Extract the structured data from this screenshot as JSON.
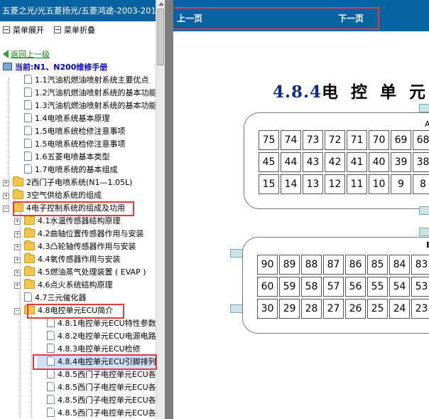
{
  "left_panel": {
    "title": "五菱之光/光五菱扬光/五菱鸿途-2003-2010-",
    "toolbar": {
      "expand_label": "菜单展开",
      "collapse_label": "菜单折叠"
    },
    "back_label": "返回上一级",
    "current_label": "当前:N1、N200维修手册",
    "tree": [
      {
        "label": "1.1汽油机燃油喷射系统主要优点",
        "type": "doc",
        "level": 1
      },
      {
        "label": "1.2汽油机燃油喷射系统的基本功能",
        "type": "doc",
        "level": 1
      },
      {
        "label": "1.3汽油机燃油喷射系统的基本功能",
        "type": "doc",
        "level": 1
      },
      {
        "label": "1.4电喷系统基本原理",
        "type": "doc",
        "level": 1
      },
      {
        "label": "1.5电喷系统检修注意事项",
        "type": "doc",
        "level": 1
      },
      {
        "label": "1.5电喷系统检修注意事项",
        "type": "doc",
        "level": 1
      },
      {
        "label": "1.6五菱电喷基本类型",
        "type": "doc",
        "level": 1
      },
      {
        "label": "1.7电喷系统的基本组成",
        "type": "doc",
        "level": 1
      },
      {
        "label": "2西门子电喷系统(N1—1.05L)",
        "type": "folder",
        "level": 0
      },
      {
        "label": "3空气供给系统的组成",
        "type": "folder",
        "level": 0
      },
      {
        "label": "4电子控制系统的组成及功用",
        "type": "folder",
        "level": 0,
        "expanded": true
      },
      {
        "label": "4.1水温传感器结构原理",
        "type": "folder",
        "level": 1
      },
      {
        "label": "4.2曲轴位置传感器作用与安装",
        "type": "folder",
        "level": 1
      },
      {
        "label": "4.3凸轮轴传感器作用与安装",
        "type": "folder",
        "level": 1
      },
      {
        "label": "4.4氧传感器作用与安装",
        "type": "folder",
        "level": 1
      },
      {
        "label": "4.5燃油蒸气处理装置 ( EVAP )",
        "type": "folder",
        "level": 1
      },
      {
        "label": "4.6点火系统结构原理",
        "type": "folder",
        "level": 1
      },
      {
        "label": "4.7三元催化器",
        "type": "doc",
        "level": 1
      },
      {
        "label": "4.8电控单元ECU简介",
        "type": "folder",
        "level": 1,
        "expanded": true
      },
      {
        "label": "4.8.1电控单元ECU特性参数",
        "type": "doc",
        "level": 2
      },
      {
        "label": "4.8.2电控单元ECU电源电路",
        "type": "doc",
        "level": 2
      },
      {
        "label": "4.8.3电控单元ECU检修",
        "type": "doc",
        "level": 2
      },
      {
        "label": "4.8.4电控单元ECU引脚排列",
        "type": "doc",
        "level": 2,
        "selected": true
      },
      {
        "label": "4.8.5西门子电控单元ECU各",
        "type": "doc",
        "level": 2
      },
      {
        "label": "4.8.5西门子电控单元ECU各",
        "type": "doc",
        "level": 2
      },
      {
        "label": "4.8.5西门子电控单元ECU各",
        "type": "doc",
        "level": 2
      },
      {
        "label": "4.8.5西门子电控单元ECU各",
        "type": "doc",
        "level": 2
      }
    ]
  },
  "right_panel": {
    "nav": {
      "prev_label": "上一页",
      "next_label": "下一页"
    },
    "section_number": "4.8.4",
    "section_title": "电 控 单 元 E",
    "connector_a_label": "A",
    "connector_b_label": "B",
    "connector_a_rows": [
      [
        "75",
        "74",
        "73",
        "72",
        "71",
        "70",
        "69",
        "68"
      ],
      [
        "45",
        "44",
        "43",
        "42",
        "41",
        "40",
        "39",
        "38"
      ],
      [
        "15",
        "14",
        "13",
        "12",
        "11",
        "10",
        "9",
        "8"
      ]
    ],
    "connector_b_rows": [
      [
        "90",
        "89",
        "88",
        "87",
        "86",
        "85",
        "84",
        "83"
      ],
      [
        "60",
        "59",
        "58",
        "57",
        "56",
        "55",
        "54",
        "53"
      ],
      [
        "30",
        "29",
        "28",
        "27",
        "26",
        "25",
        "24",
        "23"
      ]
    ]
  },
  "colors": {
    "header_blue": "#0a63a3",
    "highlight_red": "#e23b3b",
    "tab_cyan": "#cde3e8"
  }
}
